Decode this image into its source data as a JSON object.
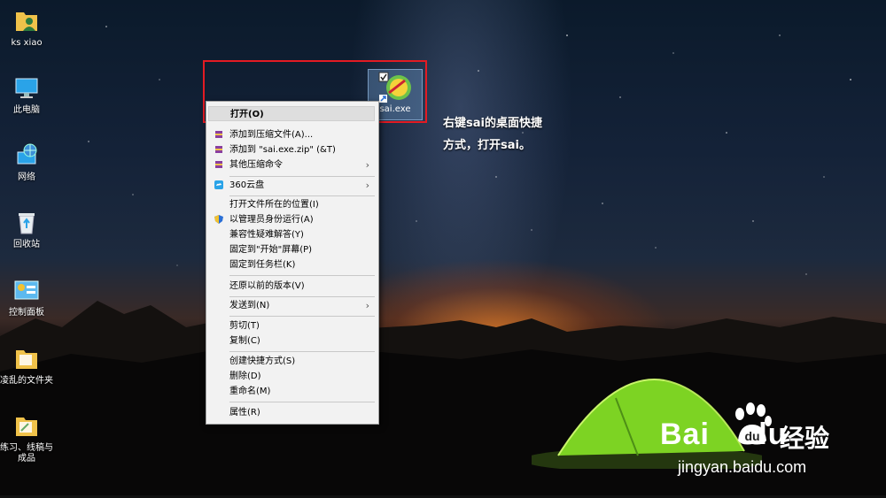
{
  "desktop": {
    "icons": [
      {
        "label": "ks xiao",
        "icon": "user-folder-icon"
      },
      {
        "label": "此电脑",
        "icon": "computer-icon"
      },
      {
        "label": "网络",
        "icon": "network-icon"
      },
      {
        "label": "回收站",
        "icon": "recycle-bin-icon"
      },
      {
        "label": "控制面板",
        "icon": "control-panel-icon"
      },
      {
        "label": "凌乱的文件夹",
        "icon": "folder-icon"
      },
      {
        "label": "练习、线稿与",
        "label2": "成品",
        "icon": "folder-icon"
      }
    ],
    "selected_file": {
      "label": "sai.exe",
      "icon": "sai-app-icon"
    }
  },
  "context_menu": {
    "items": [
      {
        "label": "打开(O)",
        "bold": true,
        "hover": true
      },
      {
        "label": "添加到压缩文件(A)...",
        "icon": "winrar-icon"
      },
      {
        "label": "添加到 \"sai.exe.zip\" (&T)",
        "icon": "winrar-icon"
      },
      {
        "label": "其他压缩命令",
        "icon": "winrar-icon",
        "submenu": true
      },
      {
        "label": "360云盘",
        "icon": "cloud-icon",
        "submenu": true
      },
      {
        "label": "打开文件所在的位置(I)"
      },
      {
        "label": "以管理员身份运行(A)",
        "icon": "shield-icon"
      },
      {
        "label": "兼容性疑难解答(Y)"
      },
      {
        "label": "固定到\"开始\"屏幕(P)"
      },
      {
        "label": "固定到任务栏(K)"
      },
      {
        "label": "还原以前的版本(V)"
      },
      {
        "label": "发送到(N)",
        "submenu": true
      },
      {
        "label": "剪切(T)"
      },
      {
        "label": "复制(C)"
      },
      {
        "label": "创建快捷方式(S)"
      },
      {
        "label": "删除(D)"
      },
      {
        "label": "重命名(M)"
      },
      {
        "label": "属性(R)"
      }
    ],
    "submenu_arrow": "›"
  },
  "annotation": {
    "line1": "右键sai的桌面快捷",
    "line2": "方式，打开sai。"
  },
  "watermark": {
    "brand": "Bai",
    "brand_suffix": "du",
    "product": "经验",
    "url": "jingyan.baidu.com"
  },
  "colors": {
    "highlight_border": "#e31b23",
    "menu_bg": "#f2f2f2",
    "tent_green": "#7dd323"
  }
}
